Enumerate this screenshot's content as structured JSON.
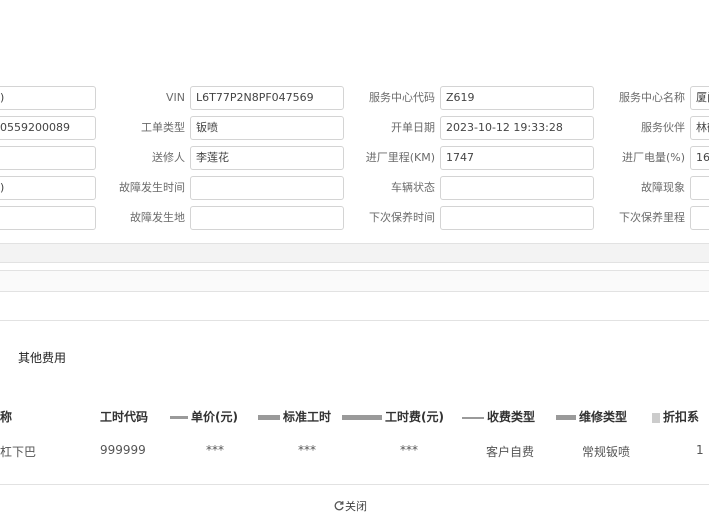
{
  "form": {
    "col1": {
      "row1_value": ")",
      "row2_value": "0559200089",
      "row3_value": "",
      "row4_value": ")",
      "row5_value": ""
    },
    "col2": {
      "vin_label": "VIN",
      "vin_value": "L6T77P2N8PF047569",
      "order_type_label": "工单类型",
      "order_type_value": "钣喷",
      "sender_label": "送修人",
      "sender_value": "李莲花",
      "fault_time_label": "故障发生时间",
      "fault_time_value": "",
      "fault_place_label": "故障发生地",
      "fault_place_value": ""
    },
    "col3": {
      "service_code_label": "服务中心代码",
      "service_code_value": "Z619",
      "open_date_label": "开单日期",
      "open_date_value": "2023-10-12 19:33:28",
      "mileage_label": "进厂里程(KM)",
      "mileage_value": "1747",
      "vehicle_status_label": "车辆状态",
      "vehicle_status_value": "",
      "next_maint_time_label": "下次保养时间",
      "next_maint_time_value": ""
    },
    "col4": {
      "service_name_label": "服务中心名称",
      "service_name_value": "厦门",
      "partner_label": "服务伙伴",
      "partner_value": "林鹤",
      "battery_label": "进厂电量(%)",
      "battery_value": "16",
      "fault_phenomenon_label": "故障现象",
      "fault_phenomenon_value": "",
      "next_maint_mileage_label": "下次保养里程",
      "next_maint_mileage_value": ""
    }
  },
  "tab_other_fees": "其他费用",
  "table": {
    "headers": [
      "称",
      "工时代码",
      "单价(元)",
      "标准工时",
      "工时费(元)",
      "收费类型",
      "维修类型",
      "折扣系"
    ],
    "rows": [
      [
        "杠下巴",
        "999999",
        "***",
        "***",
        "***",
        "客户自费",
        "常规钣喷",
        "1"
      ]
    ]
  },
  "close_label": "关闭",
  "close_icon": "refresh-icon"
}
